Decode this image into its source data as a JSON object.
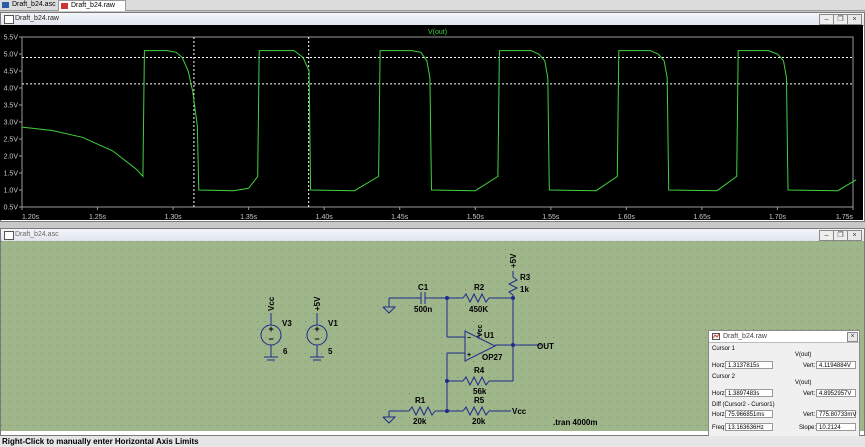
{
  "tabs": [
    {
      "label": "Draft_b24.asc"
    },
    {
      "label": "Draft_b24.raw"
    }
  ],
  "plot_window": {
    "title": "Draft_b24.raw",
    "trace_label": "V(out)",
    "trace_color": "#3fd23f",
    "y_ticks": [
      "5.5V",
      "5.0V",
      "4.5V",
      "4.0V",
      "3.5V",
      "3.0V",
      "2.5V",
      "2.0V",
      "1.5V",
      "1.0V",
      "0.5V"
    ],
    "x_ticks": [
      "1.20s",
      "1.25s",
      "1.30s",
      "1.35s",
      "1.40s",
      "1.45s",
      "1.50s",
      "1.55s",
      "1.60s",
      "1.65s",
      "1.70s",
      "1.75s"
    ]
  },
  "chart_data": {
    "type": "line",
    "title": "",
    "xlabel": "",
    "ylabel": "",
    "xlim": [
      1.2,
      1.75
    ],
    "ylim": [
      0.5,
      5.5
    ],
    "series": [
      {
        "name": "V(out)",
        "x": [
          1.2,
          1.22,
          1.24,
          1.26,
          1.276,
          1.28,
          1.281,
          1.296,
          1.302,
          1.306,
          1.31,
          1.313,
          1.316,
          1.317,
          1.34,
          1.35,
          1.356,
          1.357,
          1.38,
          1.386,
          1.39,
          1.391,
          1.42,
          1.436,
          1.437,
          1.458,
          1.464,
          1.468,
          1.47,
          1.471,
          1.5,
          1.515,
          1.516,
          1.537,
          1.542,
          1.546,
          1.548,
          1.549,
          1.58,
          1.594,
          1.595,
          1.616,
          1.621,
          1.625,
          1.627,
          1.628,
          1.66,
          1.673,
          1.674,
          1.694,
          1.7,
          1.704,
          1.706,
          1.707,
          1.74,
          1.752
        ],
        "y": [
          2.85,
          2.75,
          2.55,
          2.15,
          1.6,
          1.4,
          5.1,
          5.1,
          5.05,
          4.9,
          4.5,
          3.9,
          2.9,
          1.0,
          0.98,
          1.05,
          1.4,
          5.1,
          5.1,
          4.9,
          4.5,
          1.0,
          0.98,
          1.4,
          5.1,
          5.1,
          5.05,
          4.8,
          4.3,
          1.0,
          0.98,
          1.4,
          5.1,
          5.1,
          5.0,
          4.8,
          4.3,
          1.0,
          0.98,
          1.4,
          5.1,
          5.1,
          5.0,
          4.8,
          4.3,
          1.0,
          0.98,
          1.4,
          5.1,
          5.1,
          5.0,
          4.8,
          4.3,
          1.0,
          0.98,
          1.3
        ]
      }
    ],
    "cursors": [
      {
        "x": 1.3137815,
        "y": 4.1194884
      },
      {
        "x": 1.3897483,
        "y": 4.8952957
      }
    ],
    "grid": false
  },
  "schematic_window": {
    "title": "Draft_b24.asc",
    "labels": {
      "vcc1": "Vcc",
      "v3": "V3",
      "v3val": "6",
      "p5v1": "+5V",
      "v1": "V1",
      "v1val": "5",
      "c1": "C1",
      "c1val": "500n",
      "r2": "R2",
      "r2val": "450K",
      "r3": "R3",
      "r3val": "1k",
      "p5v2": "+5V",
      "u1": "U1",
      "u1part": "OP27",
      "u1vcc": "Vcc",
      "out": "OUT",
      "r4": "R4",
      "r4val": "56k",
      "r1": "R1",
      "r1val": "20k",
      "r5": "R5",
      "r5val": "20k",
      "vcc2": "Vcc",
      "tran": ".tran 4000m"
    }
  },
  "cursor_panel": {
    "title": "Draft_b24.raw",
    "cursor1": {
      "label": "Cursor 1",
      "signal": "V(out)",
      "horz_label": "Horz:",
      "horz": "1.3137815s",
      "vert_label": "Vert:",
      "vert": "4.1194884V"
    },
    "cursor2": {
      "label": "Cursor 2",
      "signal": "V(out)",
      "horz_label": "Horz:",
      "horz": "1.3897483s",
      "vert_label": "Vert:",
      "vert": "4.8952957V"
    },
    "diff": {
      "label": "Diff (Cursor2 - Cursor1)",
      "horz_label": "Horz:",
      "horz": "75.966851ms",
      "vert_label": "Vert:",
      "vert": "775.80733mV",
      "freq_label": "Freq:",
      "freq": "13.163636Hz",
      "slope_label": "Slope:",
      "slope": "10.2124"
    }
  },
  "status_bar": {
    "text": "Right-Click to manually enter Horizontal Axis Limits"
  }
}
